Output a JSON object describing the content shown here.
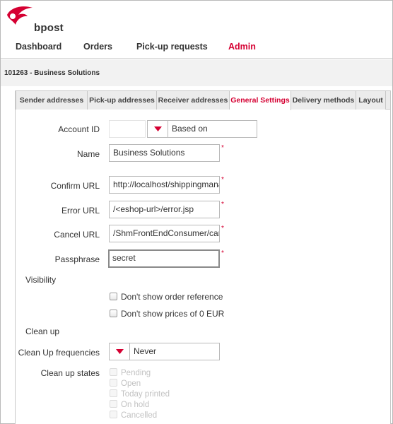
{
  "brand": {
    "name": "bpost",
    "color": "#d50032"
  },
  "nav": {
    "items": [
      {
        "label": "Dashboard"
      },
      {
        "label": "Orders"
      },
      {
        "label": "Pick-up requests"
      },
      {
        "label": "Admin",
        "active": true
      }
    ]
  },
  "breadcrumb": "101263 - Business Solutions",
  "tabs": [
    {
      "label": "Sender addresses"
    },
    {
      "label": "Pick-up addresses"
    },
    {
      "label": "Receiver addresses"
    },
    {
      "label": "General Settings",
      "active": true
    },
    {
      "label": "Delivery methods"
    },
    {
      "label": "Layout"
    }
  ],
  "form": {
    "account_id": {
      "label": "Account ID",
      "value": "",
      "select_value": "Based on"
    },
    "name": {
      "label": "Name",
      "value": "Business Solutions"
    },
    "confirm_url": {
      "label": "Confirm URL",
      "value": "http://localhost/shippingmanager"
    },
    "error_url": {
      "label": "Error URL",
      "value": "/<eshop-url>/error.jsp"
    },
    "cancel_url": {
      "label": "Cancel URL",
      "value": "/ShmFrontEndConsumer/cancel"
    },
    "passphrase": {
      "label": "Passphrase",
      "value": "secret"
    },
    "required_mark": "*"
  },
  "visibility": {
    "heading": "Visibility",
    "options": [
      {
        "label": "Don't show order reference",
        "checked": false
      },
      {
        "label": "Don't show prices of 0 EUR",
        "checked": false
      }
    ]
  },
  "cleanup": {
    "heading": "Clean up",
    "frequency": {
      "label": "Clean Up frequencies",
      "value": "Never"
    },
    "states": {
      "label": "Clean up states",
      "options": [
        {
          "label": "Pending",
          "disabled": true
        },
        {
          "label": "Open",
          "disabled": true
        },
        {
          "label": "Today printed",
          "disabled": true
        },
        {
          "label": "On hold",
          "disabled": true
        },
        {
          "label": "Cancelled",
          "disabled": true
        }
      ]
    }
  }
}
